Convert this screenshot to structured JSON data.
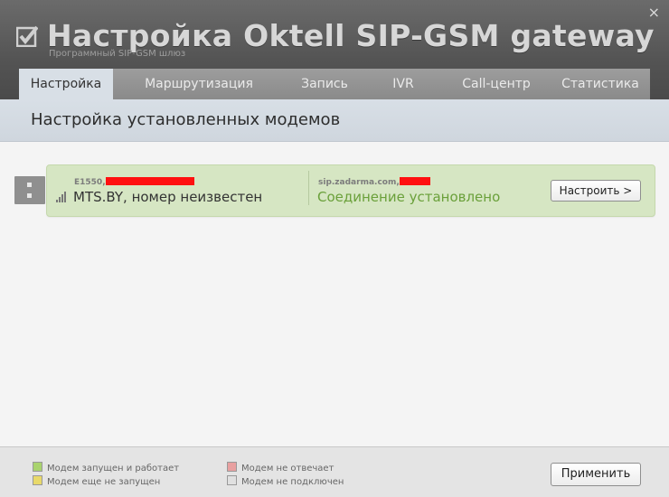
{
  "window": {
    "title": "Настройка Oktell SIP-GSM gateway",
    "subtitle": "Программный SIP-GSM шлюз",
    "close_glyph": "×"
  },
  "tabs": [
    {
      "label": "Настройка",
      "active": true
    },
    {
      "label": "Маршрутизация",
      "active": false
    },
    {
      "label": "Запись",
      "active": false
    },
    {
      "label": "IVR",
      "active": false
    },
    {
      "label": "Call-центр",
      "active": false
    },
    {
      "label": "Статистика",
      "active": false
    }
  ],
  "section": {
    "title": "Настройка установленных модемов"
  },
  "modem": {
    "model": "E1550,",
    "operator": "MTS.BY, номер неизвестен",
    "sip": "sip.zadarma.com,",
    "status": "Соединение установлено",
    "configure_label": "Настроить >",
    "status_color": "#6aa03a",
    "redaction_color": "#ff1010"
  },
  "legend": [
    {
      "label": "Модем запущен и работает",
      "color": "#a9d36e"
    },
    {
      "label": "Модем еще не запущен",
      "color": "#e8d96a"
    },
    {
      "label": "Модем не отвечает",
      "color": "#e8a0a0"
    },
    {
      "label": "Модем не подключен",
      "color": "#e0e0e0"
    }
  ],
  "footer": {
    "apply_label": "Применить"
  }
}
